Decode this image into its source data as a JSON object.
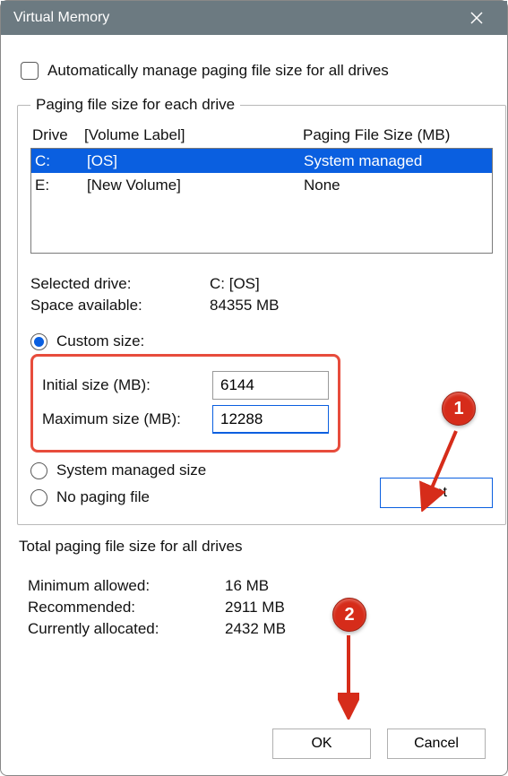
{
  "title": "Virtual Memory",
  "auto_checkbox_label": "Automatically manage paging file size for all drives",
  "group1": {
    "legend": "Paging file size for each drive",
    "headers": {
      "drive": "Drive",
      "volume": "[Volume Label]",
      "size": "Paging File Size (MB)"
    },
    "rows": [
      {
        "drive": "C:",
        "volume": "[OS]",
        "size": "System managed",
        "selected": true
      },
      {
        "drive": "E:",
        "volume": "[New Volume]",
        "size": "None",
        "selected": false
      }
    ],
    "selected_drive_label": "Selected drive:",
    "selected_drive_value": "C:  [OS]",
    "space_label": "Space available:",
    "space_value": "84355 MB",
    "radio_custom": "Custom size:",
    "initial_label": "Initial size (MB):",
    "initial_value": "6144",
    "max_label": "Maximum size (MB):",
    "max_value": "12288",
    "radio_system": "System managed size",
    "radio_none": "No paging file",
    "set_btn": "Set"
  },
  "group2": {
    "legend": "Total paging file size for all drives",
    "min_label": "Minimum allowed:",
    "min_value": "16 MB",
    "rec_label": "Recommended:",
    "rec_value": "2911 MB",
    "cur_label": "Currently allocated:",
    "cur_value": "2432 MB"
  },
  "buttons": {
    "ok": "OK",
    "cancel": "Cancel"
  },
  "markers": {
    "one": "1",
    "two": "2"
  }
}
